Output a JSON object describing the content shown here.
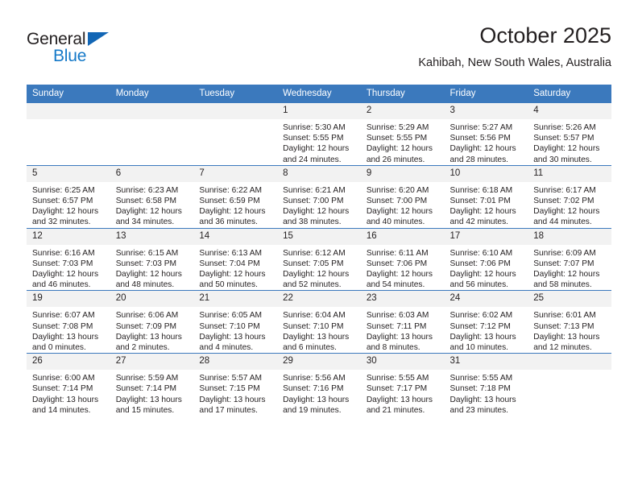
{
  "brand": {
    "name_top": "General",
    "name_bottom": "Blue",
    "accent_color": "#1579c8",
    "header_color": "#3b79bd"
  },
  "header": {
    "title": "October 2025",
    "subtitle": "Kahibah, New South Wales, Australia"
  },
  "weekdays": [
    "Sunday",
    "Monday",
    "Tuesday",
    "Wednesday",
    "Thursday",
    "Friday",
    "Saturday"
  ],
  "labels": {
    "sunrise": "Sunrise:",
    "sunset": "Sunset:",
    "daylight": "Daylight:"
  },
  "weeks": [
    [
      {
        "day": "",
        "empty": true
      },
      {
        "day": "",
        "empty": true
      },
      {
        "day": "",
        "empty": true
      },
      {
        "day": "1",
        "sunrise": "Sunrise: 5:30 AM",
        "sunset": "Sunset: 5:55 PM",
        "daylight1": "Daylight: 12 hours",
        "daylight2": "and 24 minutes."
      },
      {
        "day": "2",
        "sunrise": "Sunrise: 5:29 AM",
        "sunset": "Sunset: 5:55 PM",
        "daylight1": "Daylight: 12 hours",
        "daylight2": "and 26 minutes."
      },
      {
        "day": "3",
        "sunrise": "Sunrise: 5:27 AM",
        "sunset": "Sunset: 5:56 PM",
        "daylight1": "Daylight: 12 hours",
        "daylight2": "and 28 minutes."
      },
      {
        "day": "4",
        "sunrise": "Sunrise: 5:26 AM",
        "sunset": "Sunset: 5:57 PM",
        "daylight1": "Daylight: 12 hours",
        "daylight2": "and 30 minutes."
      }
    ],
    [
      {
        "day": "5",
        "sunrise": "Sunrise: 6:25 AM",
        "sunset": "Sunset: 6:57 PM",
        "daylight1": "Daylight: 12 hours",
        "daylight2": "and 32 minutes."
      },
      {
        "day": "6",
        "sunrise": "Sunrise: 6:23 AM",
        "sunset": "Sunset: 6:58 PM",
        "daylight1": "Daylight: 12 hours",
        "daylight2": "and 34 minutes."
      },
      {
        "day": "7",
        "sunrise": "Sunrise: 6:22 AM",
        "sunset": "Sunset: 6:59 PM",
        "daylight1": "Daylight: 12 hours",
        "daylight2": "and 36 minutes."
      },
      {
        "day": "8",
        "sunrise": "Sunrise: 6:21 AM",
        "sunset": "Sunset: 7:00 PM",
        "daylight1": "Daylight: 12 hours",
        "daylight2": "and 38 minutes."
      },
      {
        "day": "9",
        "sunrise": "Sunrise: 6:20 AM",
        "sunset": "Sunset: 7:00 PM",
        "daylight1": "Daylight: 12 hours",
        "daylight2": "and 40 minutes."
      },
      {
        "day": "10",
        "sunrise": "Sunrise: 6:18 AM",
        "sunset": "Sunset: 7:01 PM",
        "daylight1": "Daylight: 12 hours",
        "daylight2": "and 42 minutes."
      },
      {
        "day": "11",
        "sunrise": "Sunrise: 6:17 AM",
        "sunset": "Sunset: 7:02 PM",
        "daylight1": "Daylight: 12 hours",
        "daylight2": "and 44 minutes."
      }
    ],
    [
      {
        "day": "12",
        "sunrise": "Sunrise: 6:16 AM",
        "sunset": "Sunset: 7:03 PM",
        "daylight1": "Daylight: 12 hours",
        "daylight2": "and 46 minutes."
      },
      {
        "day": "13",
        "sunrise": "Sunrise: 6:15 AM",
        "sunset": "Sunset: 7:03 PM",
        "daylight1": "Daylight: 12 hours",
        "daylight2": "and 48 minutes."
      },
      {
        "day": "14",
        "sunrise": "Sunrise: 6:13 AM",
        "sunset": "Sunset: 7:04 PM",
        "daylight1": "Daylight: 12 hours",
        "daylight2": "and 50 minutes."
      },
      {
        "day": "15",
        "sunrise": "Sunrise: 6:12 AM",
        "sunset": "Sunset: 7:05 PM",
        "daylight1": "Daylight: 12 hours",
        "daylight2": "and 52 minutes."
      },
      {
        "day": "16",
        "sunrise": "Sunrise: 6:11 AM",
        "sunset": "Sunset: 7:06 PM",
        "daylight1": "Daylight: 12 hours",
        "daylight2": "and 54 minutes."
      },
      {
        "day": "17",
        "sunrise": "Sunrise: 6:10 AM",
        "sunset": "Sunset: 7:06 PM",
        "daylight1": "Daylight: 12 hours",
        "daylight2": "and 56 minutes."
      },
      {
        "day": "18",
        "sunrise": "Sunrise: 6:09 AM",
        "sunset": "Sunset: 7:07 PM",
        "daylight1": "Daylight: 12 hours",
        "daylight2": "and 58 minutes."
      }
    ],
    [
      {
        "day": "19",
        "sunrise": "Sunrise: 6:07 AM",
        "sunset": "Sunset: 7:08 PM",
        "daylight1": "Daylight: 13 hours",
        "daylight2": "and 0 minutes."
      },
      {
        "day": "20",
        "sunrise": "Sunrise: 6:06 AM",
        "sunset": "Sunset: 7:09 PM",
        "daylight1": "Daylight: 13 hours",
        "daylight2": "and 2 minutes."
      },
      {
        "day": "21",
        "sunrise": "Sunrise: 6:05 AM",
        "sunset": "Sunset: 7:10 PM",
        "daylight1": "Daylight: 13 hours",
        "daylight2": "and 4 minutes."
      },
      {
        "day": "22",
        "sunrise": "Sunrise: 6:04 AM",
        "sunset": "Sunset: 7:10 PM",
        "daylight1": "Daylight: 13 hours",
        "daylight2": "and 6 minutes."
      },
      {
        "day": "23",
        "sunrise": "Sunrise: 6:03 AM",
        "sunset": "Sunset: 7:11 PM",
        "daylight1": "Daylight: 13 hours",
        "daylight2": "and 8 minutes."
      },
      {
        "day": "24",
        "sunrise": "Sunrise: 6:02 AM",
        "sunset": "Sunset: 7:12 PM",
        "daylight1": "Daylight: 13 hours",
        "daylight2": "and 10 minutes."
      },
      {
        "day": "25",
        "sunrise": "Sunrise: 6:01 AM",
        "sunset": "Sunset: 7:13 PM",
        "daylight1": "Daylight: 13 hours",
        "daylight2": "and 12 minutes."
      }
    ],
    [
      {
        "day": "26",
        "sunrise": "Sunrise: 6:00 AM",
        "sunset": "Sunset: 7:14 PM",
        "daylight1": "Daylight: 13 hours",
        "daylight2": "and 14 minutes."
      },
      {
        "day": "27",
        "sunrise": "Sunrise: 5:59 AM",
        "sunset": "Sunset: 7:14 PM",
        "daylight1": "Daylight: 13 hours",
        "daylight2": "and 15 minutes."
      },
      {
        "day": "28",
        "sunrise": "Sunrise: 5:57 AM",
        "sunset": "Sunset: 7:15 PM",
        "daylight1": "Daylight: 13 hours",
        "daylight2": "and 17 minutes."
      },
      {
        "day": "29",
        "sunrise": "Sunrise: 5:56 AM",
        "sunset": "Sunset: 7:16 PM",
        "daylight1": "Daylight: 13 hours",
        "daylight2": "and 19 minutes."
      },
      {
        "day": "30",
        "sunrise": "Sunrise: 5:55 AM",
        "sunset": "Sunset: 7:17 PM",
        "daylight1": "Daylight: 13 hours",
        "daylight2": "and 21 minutes."
      },
      {
        "day": "31",
        "sunrise": "Sunrise: 5:55 AM",
        "sunset": "Sunset: 7:18 PM",
        "daylight1": "Daylight: 13 hours",
        "daylight2": "and 23 minutes."
      },
      {
        "day": "",
        "empty": true
      }
    ]
  ]
}
